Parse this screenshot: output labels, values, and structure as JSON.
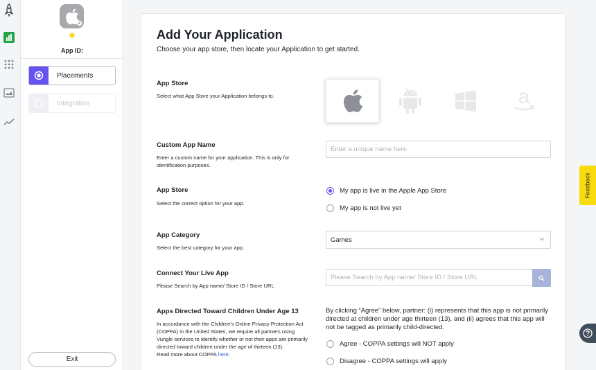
{
  "sidebar": {
    "app_id_label": "App ID:",
    "steps": [
      {
        "label": "Placements",
        "state": "active"
      },
      {
        "label": "Integration",
        "state": "inactive"
      }
    ],
    "exit_label": "Exit",
    "rail_icons": [
      "rocket-icon",
      "bar-chart-icon",
      "grid-icon",
      "image-icon",
      "trend-icon"
    ]
  },
  "header": {
    "title": "Add Your Application",
    "subtitle": "Choose your app store, then locate your Application to get started."
  },
  "sections": {
    "app_store": {
      "label": "App Store",
      "desc": "Select what App Store your Application belongs to.",
      "stores": [
        "apple-icon",
        "android-icon",
        "windows-icon",
        "amazon-icon"
      ],
      "selected": "apple-icon"
    },
    "custom_name": {
      "label": "Custom App Name",
      "desc": "Enter a custom name for your application. This is only for identification purposes.",
      "placeholder": "Enter a unique name here",
      "value": ""
    },
    "app_store_status": {
      "label": "App Store",
      "desc": "Select the correct option for your app.",
      "options": [
        "My app is live in the Apple App Store",
        "My app is not live yet"
      ],
      "selected_index": 0
    },
    "category": {
      "label": "App Category",
      "desc": "Select the best category for your app.",
      "value": "Games"
    },
    "connect": {
      "label": "Connect Your Live App",
      "desc": "Please Search by App name/ Store ID / Store URL",
      "placeholder": "Please Search by App name/ Store ID / Store URL"
    },
    "coppa": {
      "label": "Apps Directed Toward Children Under Age 13",
      "desc": "In accordance with the Children's Online Privacy Protection Act (COPPA) in the United States, we require all partners using Vungle services to identify whether or not their apps are primarily directed toward children under the age of thirteen (13).",
      "read_more": "Read more about COPPA ",
      "link_text": "here",
      "link_suffix": ".",
      "statement": "By clicking “Agree” below, partner: (i) represents that this app is not primarily directed at children under age thirteen (13), and (ii) agrees that this app will not be tagged as primarily child-directed.",
      "options": [
        "Agree - COPPA settings will NOT apply",
        "Disagree - COPPA settings will apply"
      ]
    }
  },
  "feedback_label": "Feedback",
  "colors": {
    "accent": "#6453f0",
    "feedback": "#f7db0f",
    "help": "#3f4c5a",
    "link": "#2e5de1"
  }
}
